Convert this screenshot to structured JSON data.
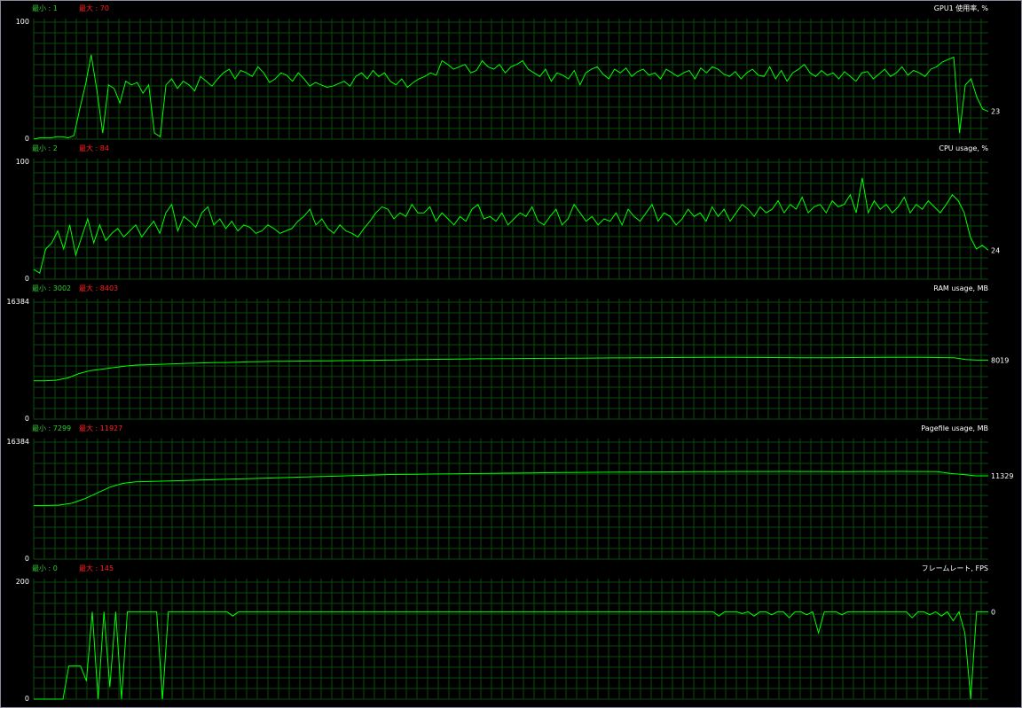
{
  "labels": {
    "min_prefix": "最小 : ",
    "max_prefix": "最大 : "
  },
  "colors": {
    "line": "#00ff00",
    "grid": "#0b4a0b",
    "min_text": "#2ecc2e",
    "max_text": "#ff2020",
    "text": "#ffffff",
    "background": "#000000"
  },
  "chart_data": [
    {
      "type": "line",
      "title": "GPU1 使用率, %",
      "ylim": [
        0,
        100
      ],
      "y_max_label": "100",
      "y_min_label": "0",
      "min_label": "1",
      "max_label": "70",
      "current_label": "23",
      "series": [
        {
          "values": [
            0,
            1,
            1,
            1,
            2,
            2,
            1,
            3,
            25,
            45,
            70,
            40,
            5,
            45,
            42,
            30,
            48,
            45,
            47,
            38,
            45,
            5,
            2,
            45,
            50,
            42,
            48,
            45,
            40,
            52,
            48,
            44,
            50,
            55,
            58,
            50,
            57,
            55,
            52,
            60,
            55,
            47,
            50,
            55,
            53,
            48,
            55,
            50,
            44,
            47,
            45,
            43,
            44,
            46,
            48,
            44,
            52,
            55,
            50,
            57,
            52,
            55,
            48,
            45,
            50,
            43,
            47,
            50,
            52,
            55,
            53,
            65,
            62,
            58,
            60,
            62,
            55,
            57,
            65,
            60,
            58,
            62,
            55,
            60,
            62,
            65,
            58,
            55,
            52,
            58,
            48,
            55,
            53,
            50,
            57,
            45,
            55,
            58,
            60,
            54,
            50,
            58,
            55,
            59,
            52,
            56,
            58,
            53,
            55,
            50,
            58,
            55,
            52,
            55,
            57,
            50,
            59,
            55,
            60,
            58,
            54,
            52,
            56,
            50,
            55,
            58,
            53,
            52,
            60,
            50,
            57,
            48,
            55,
            58,
            62,
            55,
            52,
            57,
            53,
            55,
            50,
            56,
            52,
            48,
            55,
            56,
            50,
            54,
            58,
            52,
            55,
            60,
            53,
            57,
            55,
            52,
            58,
            60,
            64,
            66,
            68,
            5,
            45,
            50,
            35,
            25,
            23
          ]
        }
      ]
    },
    {
      "type": "line",
      "title": "CPU usage, %",
      "ylim": [
        0,
        100
      ],
      "y_max_label": "100",
      "y_min_label": "0",
      "min_label": "2",
      "max_label": "84",
      "current_label": "24",
      "series": [
        {
          "values": [
            8,
            5,
            25,
            30,
            40,
            25,
            45,
            20,
            35,
            50,
            30,
            45,
            32,
            38,
            42,
            35,
            40,
            45,
            35,
            42,
            48,
            38,
            55,
            62,
            40,
            52,
            48,
            43,
            55,
            60,
            45,
            50,
            42,
            48,
            40,
            45,
            43,
            38,
            40,
            45,
            42,
            38,
            40,
            42,
            48,
            52,
            58,
            45,
            50,
            42,
            38,
            45,
            40,
            38,
            35,
            42,
            48,
            55,
            60,
            58,
            50,
            55,
            52,
            62,
            55,
            55,
            60,
            48,
            55,
            50,
            45,
            52,
            48,
            58,
            62,
            50,
            52,
            48,
            55,
            45,
            50,
            55,
            52,
            60,
            48,
            45,
            52,
            58,
            45,
            50,
            62,
            55,
            48,
            52,
            45,
            50,
            48,
            55,
            45,
            58,
            52,
            48,
            55,
            62,
            48,
            55,
            52,
            45,
            50,
            58,
            52,
            55,
            48,
            60,
            52,
            58,
            48,
            55,
            62,
            58,
            52,
            60,
            55,
            58,
            65,
            55,
            62,
            58,
            68,
            55,
            60,
            62,
            55,
            65,
            60,
            62,
            70,
            55,
            84,
            55,
            65,
            58,
            62,
            55,
            60,
            68,
            55,
            62,
            58,
            65,
            60,
            55,
            62,
            70,
            65,
            55,
            35,
            25,
            28,
            24
          ]
        }
      ]
    },
    {
      "type": "line",
      "title": "RAM usage, MB",
      "ylim": [
        0,
        16384
      ],
      "y_max_label": "16384",
      "y_min_label": "0",
      "min_label": "3002",
      "max_label": "8403",
      "current_label": "8019",
      "series": [
        {
          "values": [
            5200,
            5200,
            5300,
            5600,
            6200,
            6600,
            6800,
            7000,
            7200,
            7350,
            7400,
            7450,
            7500,
            7550,
            7600,
            7650,
            7700,
            7700,
            7750,
            7800,
            7820,
            7850,
            7870,
            7880,
            7900,
            7920,
            7930,
            7950,
            7960,
            7980,
            8000,
            8020,
            8050,
            8080,
            8100,
            8120,
            8140,
            8160,
            8180,
            8200,
            8210,
            8220,
            8230,
            8240,
            8250,
            8260,
            8270,
            8280,
            8290,
            8300,
            8310,
            8320,
            8330,
            8340,
            8350,
            8360,
            8370,
            8380,
            8390,
            8400,
            8403,
            8400,
            8400,
            8390,
            8380,
            8370,
            8360,
            8350,
            8340,
            8340,
            8350,
            8360,
            8370,
            8380,
            8390,
            8400,
            8400,
            8403,
            8400,
            8380,
            8360,
            8340,
            8100,
            8019,
            8019
          ]
        }
      ]
    },
    {
      "type": "line",
      "title": "Pagefile usage, MB",
      "ylim": [
        0,
        16384
      ],
      "y_max_label": "16384",
      "y_min_label": "0",
      "min_label": "7299",
      "max_label": "11927",
      "current_label": "11329",
      "series": [
        {
          "values": [
            7300,
            7300,
            7350,
            7600,
            8200,
            9000,
            9800,
            10300,
            10500,
            10550,
            10600,
            10650,
            10700,
            10750,
            10800,
            10850,
            10900,
            10950,
            11000,
            11050,
            11100,
            11150,
            11200,
            11250,
            11300,
            11350,
            11400,
            11450,
            11500,
            11520,
            11540,
            11560,
            11580,
            11600,
            11620,
            11640,
            11660,
            11680,
            11700,
            11720,
            11740,
            11760,
            11780,
            11800,
            11810,
            11820,
            11830,
            11840,
            11850,
            11860,
            11870,
            11880,
            11890,
            11900,
            11900,
            11910,
            11910,
            11920,
            11920,
            11927,
            11920,
            11920,
            11910,
            11900,
            11900,
            11910,
            11920,
            11920,
            11927,
            11920,
            11910,
            11900,
            11650,
            11500,
            11329,
            11329
          ]
        }
      ]
    },
    {
      "type": "line",
      "title": "フレームレート, FPS",
      "ylim": [
        0,
        200
      ],
      "y_max_label": "200",
      "y_min_label": "0",
      "min_label": "0",
      "max_label": "145",
      "current_label": "0",
      "series": [
        {
          "values": [
            0,
            0,
            0,
            0,
            0,
            0,
            55,
            55,
            55,
            30,
            145,
            0,
            145,
            20,
            145,
            0,
            145,
            145,
            145,
            145,
            145,
            145,
            0,
            145,
            145,
            145,
            145,
            145,
            145,
            145,
            145,
            145,
            145,
            145,
            138,
            145,
            145,
            145,
            145,
            145,
            145,
            145,
            145,
            145,
            145,
            145,
            145,
            145,
            145,
            145,
            145,
            145,
            145,
            145,
            145,
            145,
            145,
            145,
            145,
            145,
            145,
            145,
            145,
            145,
            145,
            145,
            145,
            145,
            145,
            145,
            145,
            145,
            145,
            145,
            145,
            145,
            145,
            145,
            145,
            145,
            145,
            145,
            145,
            145,
            145,
            145,
            145,
            145,
            145,
            145,
            145,
            145,
            145,
            145,
            145,
            145,
            145,
            145,
            145,
            145,
            145,
            145,
            145,
            145,
            145,
            145,
            145,
            145,
            145,
            145,
            145,
            145,
            145,
            145,
            145,
            145,
            145,
            138,
            145,
            145,
            145,
            142,
            145,
            138,
            145,
            145,
            140,
            145,
            145,
            135,
            145,
            145,
            140,
            145,
            110,
            145,
            145,
            145,
            140,
            145,
            145,
            145,
            145,
            145,
            145,
            145,
            145,
            145,
            145,
            145,
            135,
            145,
            145,
            140,
            145,
            138,
            145,
            130,
            145,
            110,
            0,
            145,
            145,
            145
          ]
        }
      ]
    }
  ]
}
